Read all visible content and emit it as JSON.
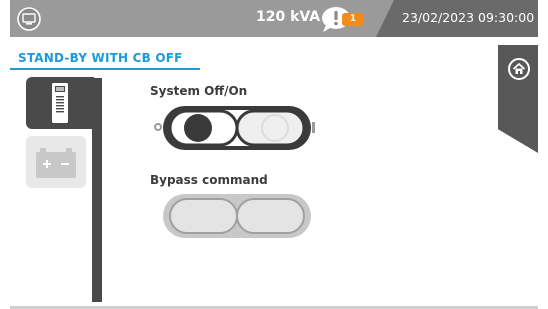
{
  "header": {
    "power_rating": "120 kVA",
    "alarm_count": "1",
    "datetime": "23/02/2023 09:30:00",
    "icons": [
      "monitor-icon",
      "alarm-bubble-icon",
      "home-icon"
    ]
  },
  "status": {
    "mode_title": "STAND-BY WITH CB OFF"
  },
  "sidebar": {
    "tabs": [
      {
        "name": "ups-cabinet-tab",
        "icon": "ups-cabinet-icon",
        "active": true
      },
      {
        "name": "battery-tab",
        "icon": "battery-icon",
        "active": false
      }
    ]
  },
  "controls": {
    "system_switch": {
      "label": "System Off/On",
      "off_symbol": "O",
      "on_symbol": "I",
      "state": "off",
      "enabled": true
    },
    "bypass_command": {
      "label": "Bypass command",
      "enabled": false
    }
  },
  "colors": {
    "header_bg": "#9a9a9a",
    "date_panel_bg": "#6a6a6a",
    "accent_blue": "#1e9ad6",
    "alarm_orange": "#f08c1e",
    "switch_dark": "#3a3a3a",
    "disabled_gray": "#c8c8c8"
  }
}
